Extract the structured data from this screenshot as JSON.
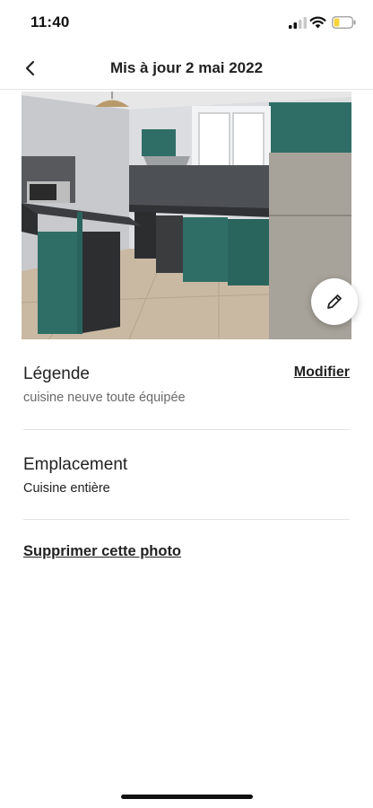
{
  "status_bar": {
    "time": "11:40",
    "battery_color": "#f5d33a"
  },
  "header": {
    "title": "Mis à jour 2 mai 2022",
    "back_icon": "chevron-left-icon"
  },
  "photo": {
    "subject": "kitchen-photo",
    "edit_icon": "pencil-icon"
  },
  "caption": {
    "title": "Légende",
    "value": "cuisine neuve toute équipée",
    "edit_label": "Modifier"
  },
  "location": {
    "title": "Emplacement",
    "value": "Cuisine entière"
  },
  "actions": {
    "delete_label": "Supprimer cette photo"
  },
  "colors": {
    "text": "#222222",
    "muted": "#6a6a6a",
    "divider": "#e4e4e4",
    "cabinet_teal": "#2f6e66"
  }
}
